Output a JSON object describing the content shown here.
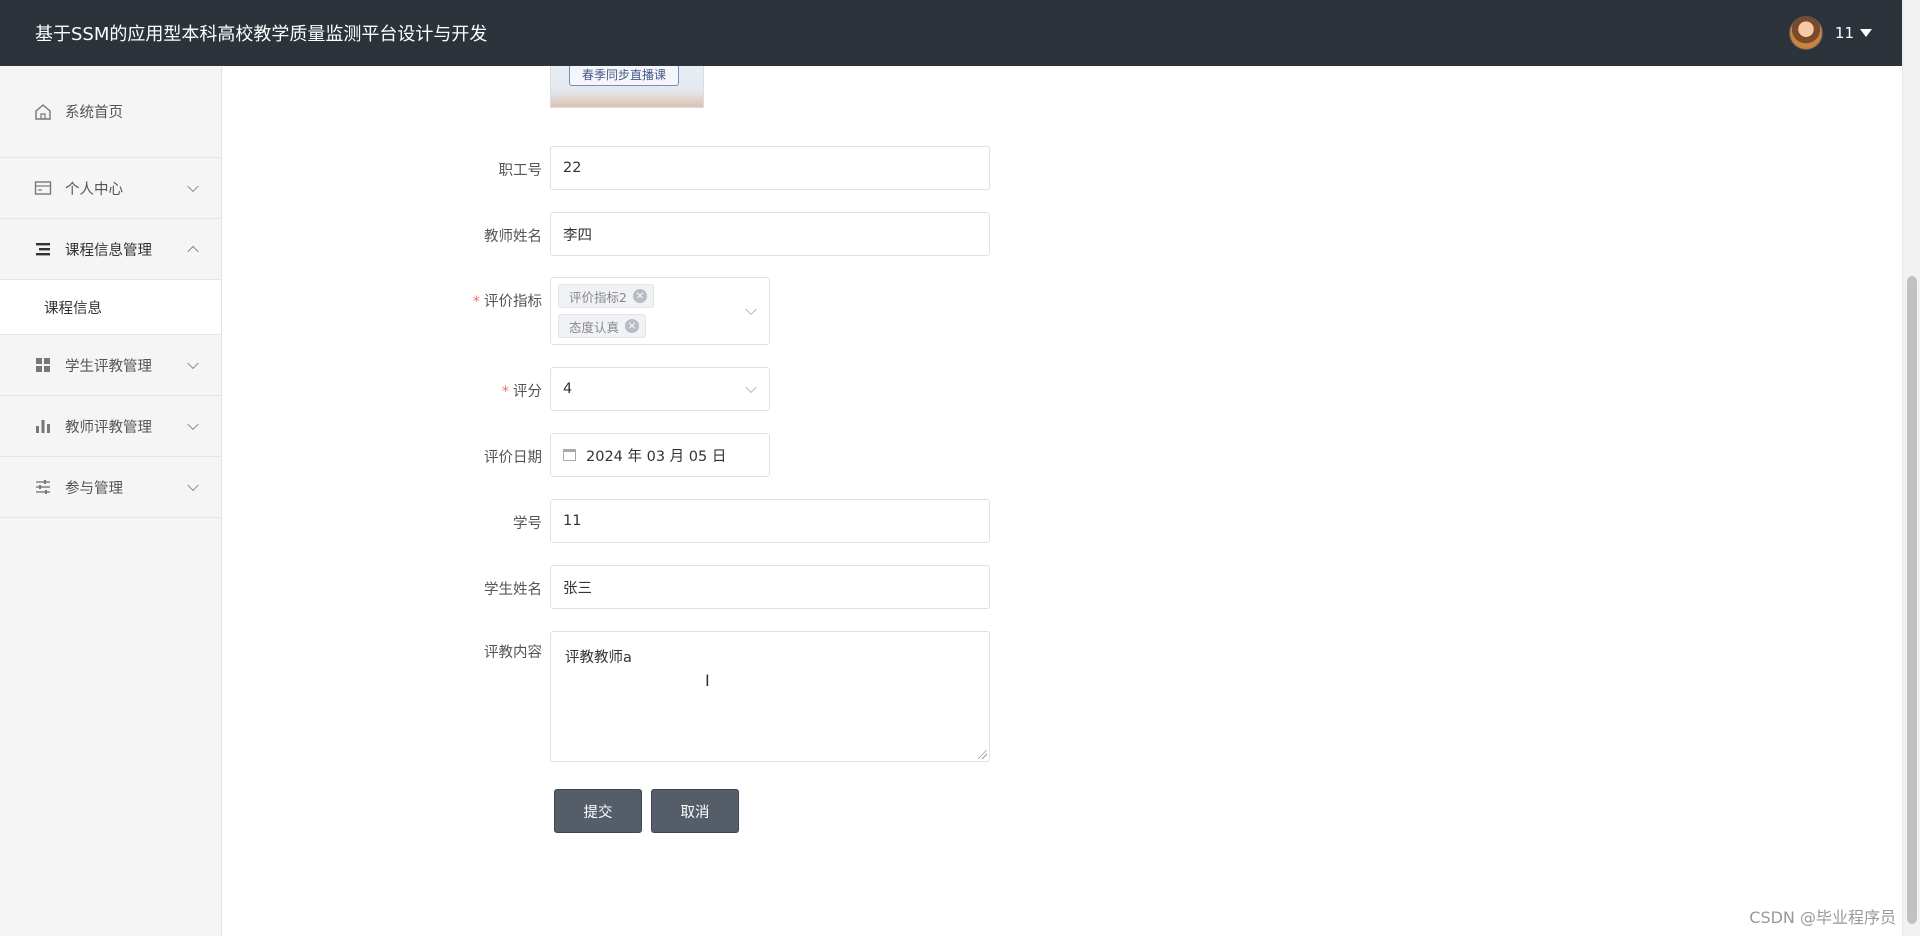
{
  "header": {
    "title": "基于SSM的应用型本科高校教学质量监测平台设计与开发",
    "user_name": "11"
  },
  "sidebar": {
    "items": [
      {
        "label": "系统首页",
        "icon": "home-icon"
      },
      {
        "label": "个人中心",
        "icon": "card-icon"
      },
      {
        "label": "课程信息管理",
        "icon": "list-icon"
      },
      {
        "label": "学生评教管理",
        "icon": "grid-icon"
      },
      {
        "label": "教师评教管理",
        "icon": "bar-chart-icon"
      },
      {
        "label": "参与管理",
        "icon": "sliders-icon"
      }
    ],
    "submenu": [
      "课程信息"
    ]
  },
  "form": {
    "thumbnail_text": "春季同步直播课",
    "staff_no": {
      "label": "职工号",
      "value": "22"
    },
    "teacher_name": {
      "label": "教师姓名",
      "value": "李四"
    },
    "indicators": {
      "label": "评价指标",
      "required_mark": "*",
      "tags": [
        "评价指标2",
        "态度认真"
      ]
    },
    "score": {
      "label": "评分",
      "required_mark": "*",
      "value": "4"
    },
    "eval_date": {
      "label": "评价日期",
      "value": "2024 年 03 月 05 日"
    },
    "student_no": {
      "label": "学号",
      "value": "11"
    },
    "student_name": {
      "label": "学生姓名",
      "value": "张三"
    },
    "content": {
      "label": "评教内容",
      "value": "评教教师a"
    },
    "submit_label": "提交",
    "cancel_label": "取消"
  },
  "watermark": "CSDN @毕业程序员"
}
